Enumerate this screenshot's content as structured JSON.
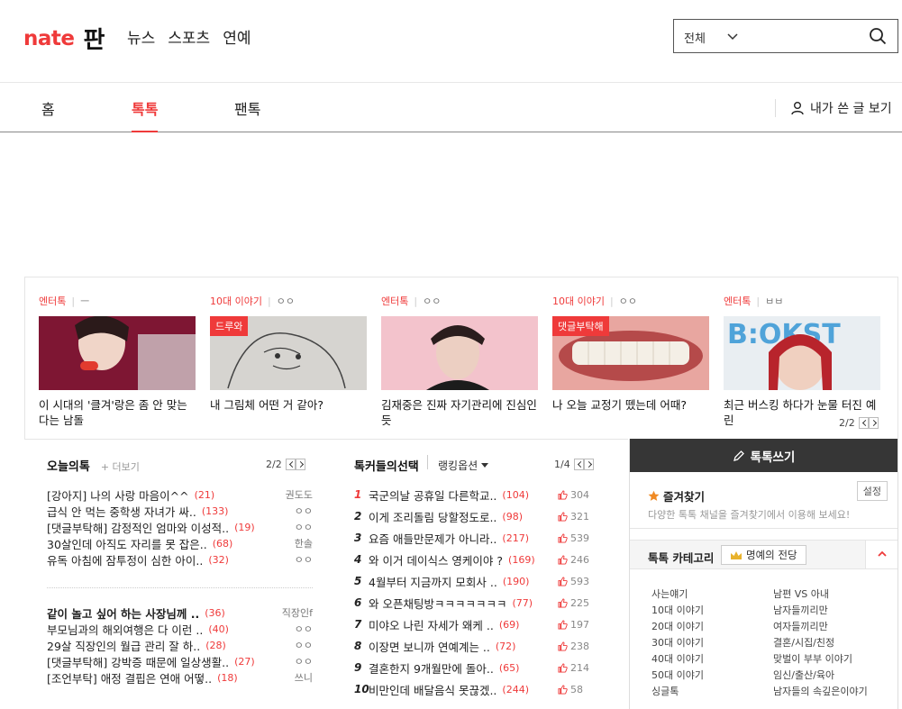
{
  "header": {
    "logo_nate": "nate",
    "logo_pan": "판",
    "nav": [
      "뉴스",
      "스포츠",
      "연예"
    ],
    "search_scope": "전체"
  },
  "tabs": {
    "items": [
      "홈",
      "톡톡",
      "팬톡"
    ],
    "active": "톡톡",
    "my_posts": "내가 쓴 글 보기"
  },
  "cards": [
    {
      "category": "엔터톡",
      "author": "ㅡ",
      "title": "이 시대의 '클겨'랑은 좀 안 맞는다는 남돌",
      "badge": ""
    },
    {
      "category": "10대 이야기",
      "author": "ㅇㅇ",
      "title": "내 그림체 어떤 거 같아?",
      "badge": "드루와"
    },
    {
      "category": "엔터톡",
      "author": "ㅇㅇ",
      "title": "김재중은 진짜 자기관리에 진심인 듯",
      "badge": ""
    },
    {
      "category": "10대 이야기",
      "author": "ㅇㅇ",
      "title": "나 오늘 교정기 뗐는데 어때?",
      "badge": "댓글부탁해"
    },
    {
      "category": "엔터톡",
      "author": "ㅂㅂ",
      "title": "최근 버스킹 하다가 눈물 터진 예린",
      "badge": ""
    }
  ],
  "cards_pager": "2/2",
  "today": {
    "title": "오늘의톡",
    "more": "+ 더보기",
    "pager": "2/2",
    "group1": [
      {
        "title": "[강아지] 나의 사랑 마음이^^",
        "count": "(21)",
        "writer": "권도도"
      },
      {
        "title": "급식 안 먹는 중학생 자녀가 싸..",
        "count": "(133)",
        "writer": "ㅇㅇ"
      },
      {
        "title": "[댓글부탁해] 감정적인 엄마와 이성적..",
        "count": "(19)",
        "writer": "ㅇㅇ"
      },
      {
        "title": "30살인데 아직도 자리를 못 잡은..",
        "count": "(68)",
        "writer": "한솔"
      },
      {
        "title": "유독 아침에 잠투정이 심한 아이..",
        "count": "(32)",
        "writer": "ㅇㅇ"
      }
    ],
    "group2": [
      {
        "title": "같이 놀고 싶어 하는 사장님께 ..",
        "count": "(36)",
        "writer": "직장인f"
      },
      {
        "title": "부모님과의 해외여행은 다 이런 ..",
        "count": "(40)",
        "writer": "ㅇㅇ"
      },
      {
        "title": "29살 직장인의 월급 관리 잘 하..",
        "count": "(28)",
        "writer": "ㅇㅇ"
      },
      {
        "title": "[댓글부탁해] 강박증 때문에 일상생활..",
        "count": "(27)",
        "writer": "ㅇㅇ"
      },
      {
        "title": "[조언부탁] 애정 결핍은 연애 어떻..",
        "count": "(18)",
        "writer": "쓰니"
      }
    ]
  },
  "ranking": {
    "title": "톡커들의선택",
    "option": "랭킹옵션",
    "pager": "1/4",
    "items": [
      {
        "rank": "1",
        "title": "국군의날 공휴일 다른학교..",
        "count": "(104)",
        "likes": "304"
      },
      {
        "rank": "2",
        "title": "이게 조리돌림 당할정도로..",
        "count": "(98)",
        "likes": "321"
      },
      {
        "rank": "3",
        "title": "요즘 애들만문제가 아니라..",
        "count": "(217)",
        "likes": "539"
      },
      {
        "rank": "4",
        "title": "와 이거 데이식스 영케이야 ?",
        "count": "(169)",
        "likes": "246"
      },
      {
        "rank": "5",
        "title": "4월부터 지금까지 모회사 ..",
        "count": "(190)",
        "likes": "593"
      },
      {
        "rank": "6",
        "title": "와 오픈채팅방ㅋㅋㅋㅋㅋㅋㅋ",
        "count": "(77)",
        "likes": "225"
      },
      {
        "rank": "7",
        "title": "미야오 나린 자세가 왜케 ..",
        "count": "(69)",
        "likes": "197"
      },
      {
        "rank": "8",
        "title": "이장면 보니까 연예계는 ..",
        "count": "(72)",
        "likes": "238"
      },
      {
        "rank": "9",
        "title": "결혼한지 9개월만에 돌아..",
        "count": "(65)",
        "likes": "214"
      },
      {
        "rank": "10",
        "title": "비만인데 배달음식 못끊겠..",
        "count": "(244)",
        "likes": "58"
      }
    ]
  },
  "side": {
    "write": "톡톡쓰기",
    "fav_title": "즐겨찾기",
    "fav_desc": "다양한 톡톡 채널을 즐겨찾기에서 이용해 보세요!",
    "setting": "설정",
    "cat_title": "톡톡 카테고리",
    "hall": "명예의 전당",
    "cats_left": [
      "사는얘기",
      "10대 이야기",
      "20대 이야기",
      "30대 이야기",
      "40대 이야기",
      "50대 이야기",
      "싱글톡"
    ],
    "cats_right": [
      "남편 VS 아내",
      "남자들끼리만",
      "여자들끼리만",
      "결혼/시집/친정",
      "맞벌이 부부 이야기",
      "임신/출산/육아",
      "남자들의 속깊은이야기"
    ]
  }
}
